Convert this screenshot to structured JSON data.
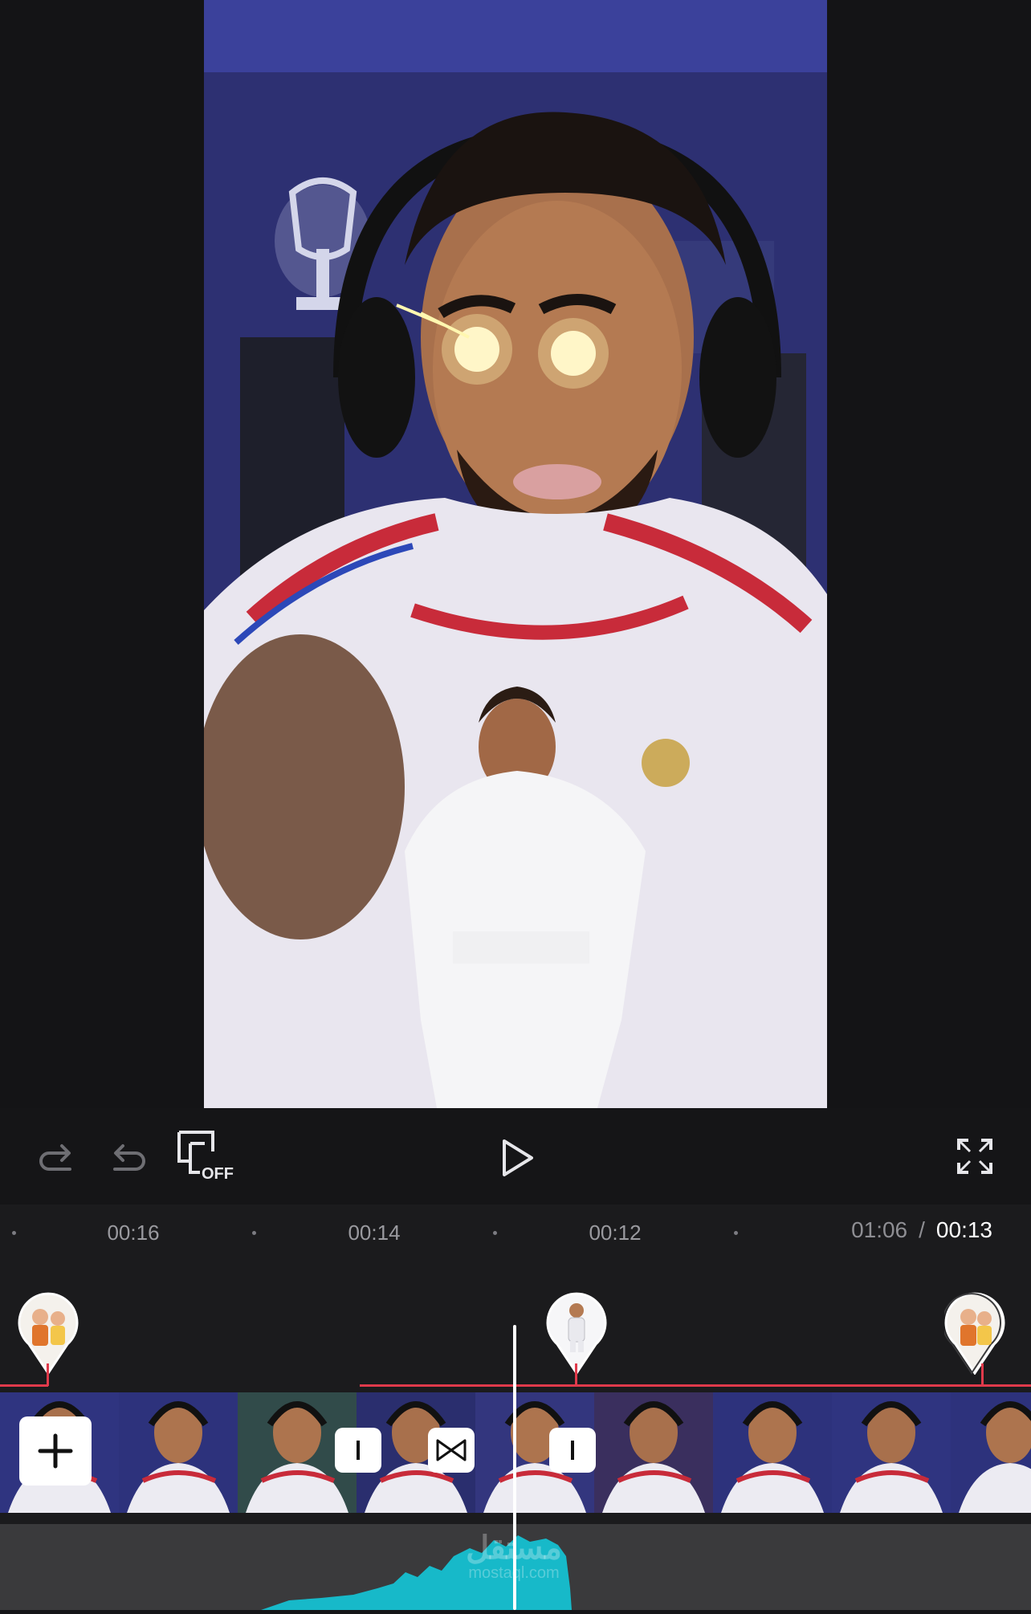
{
  "controls": {
    "redo_icon": "redo-icon",
    "undo_icon": "undo-icon",
    "keyframe_label": "OFF",
    "play_icon": "play-icon",
    "fullscreen_icon": "fullscreen-icon"
  },
  "timeline": {
    "ticks": [
      "00:16",
      "00:14",
      "00:12"
    ],
    "total_time": "01:06",
    "separator": "/",
    "current_time": "00:13"
  },
  "watermark": {
    "arabic": "مستقل",
    "latin": "mostaql.com"
  },
  "colors": {
    "background": "#151517",
    "accent_red": "#e03a4b",
    "audio_wave": "#17b9c9",
    "playhead": "#ffffff"
  }
}
